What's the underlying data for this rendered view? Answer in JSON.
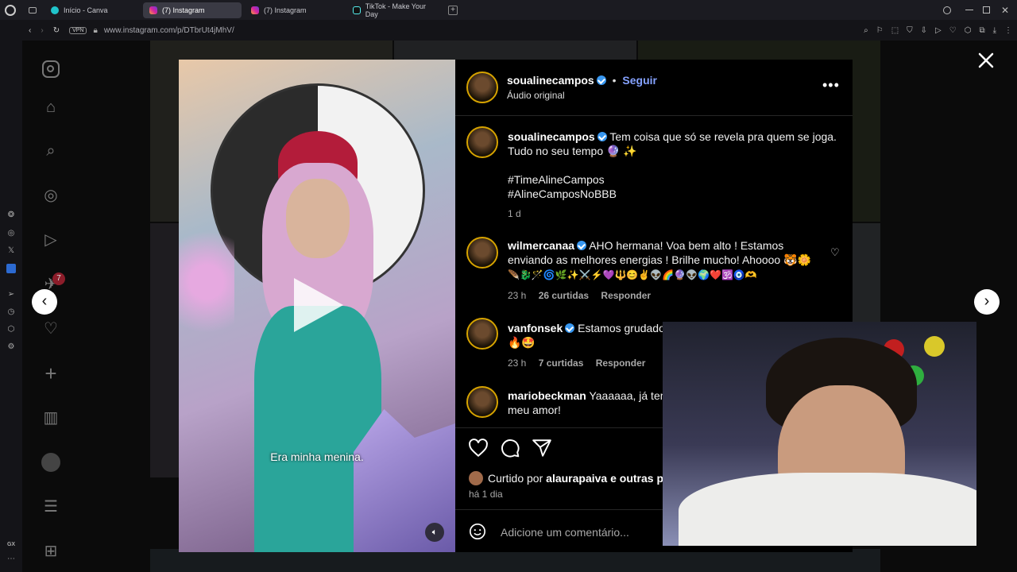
{
  "browser": {
    "tabs": [
      {
        "label": "Início - Canva",
        "active": false
      },
      {
        "label": "(7) Instagram",
        "active": true
      },
      {
        "label": "(7) Instagram",
        "active": false
      },
      {
        "label": "TikTok - Make Your Day",
        "active": false
      }
    ],
    "vpn_label": "VPN",
    "url": "www.instagram.com/p/DTbrUt4jMhV/",
    "gx_label": "GX"
  },
  "ig_sidebar": {
    "notification_count": "7"
  },
  "video": {
    "caption": "Era minha menina."
  },
  "post": {
    "author": "soualinecampos",
    "follow_label": "Seguir",
    "separator": "•",
    "audio": "Áudio original",
    "caption_line1": "Tem coisa que só se revela pra quem se joga.",
    "caption_line2": "Tudo no seu tempo",
    "caption_emoji": "🔮 ✨",
    "hashtag1": "#TimeAlineCampos",
    "hashtag2": "#AlineCamposNoBBB",
    "age": "1 d"
  },
  "comments": [
    {
      "author": "wilmercanaa",
      "line1": "AHO hermana! Voa bem alto ! Estamos",
      "line2": "enviando as melhores energias ! Brilhe mucho! Ahoooo 🐯🌼",
      "line3": "🪶🐉🪄🌀🌿✨⚔️⚡💜🔱😊✌️👽🌈🔮👽🌍❤️🕉️🧿🫶",
      "time": "23 h",
      "likes": "26 curtidas",
      "reply": "Responder"
    },
    {
      "author": "vanfonsek",
      "line1": "Estamos grudados",
      "line2": "🔥🤩",
      "time": "23 h",
      "likes": "7 curtidas",
      "reply": "Responder"
    },
    {
      "author": "mariobeckman",
      "line1": "Yaaaaaa, já tem",
      "line2": "meu amor!"
    }
  ],
  "footer": {
    "liked_prefix": "Curtido por",
    "liked_user": "alaurapaiva",
    "liked_suffix": "e outras pe",
    "posted": "há 1 dia",
    "comment_placeholder": "Adicione um comentário..."
  }
}
